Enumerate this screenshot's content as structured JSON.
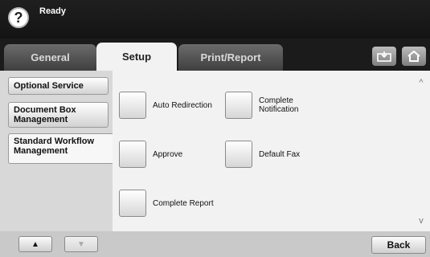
{
  "header": {
    "help_glyph": "?",
    "status": "Ready"
  },
  "tabs": [
    {
      "label": "General"
    },
    {
      "label": "Setup"
    },
    {
      "label": "Print/Report"
    }
  ],
  "toolbar": {
    "icons": [
      "tray-icon",
      "home-icon"
    ]
  },
  "sidebar": {
    "items": [
      {
        "label": "Optional Service"
      },
      {
        "label": "Document Box Management"
      },
      {
        "label": "Standard Workflow Management"
      }
    ]
  },
  "options": [
    {
      "label": "Auto Redirection"
    },
    {
      "label": "Complete Notification"
    },
    {
      "label": "Approve"
    },
    {
      "label": "Default Fax"
    },
    {
      "label": "Complete Report"
    }
  ],
  "scroll": {
    "up": "^",
    "down": "v"
  },
  "footer": {
    "up_glyph": "▲",
    "down_glyph": "▼",
    "back_label": "Back"
  },
  "colors": {
    "header_bg": "#1b1b1b",
    "active_tab": "#f2f2f2",
    "sidebar_bg": "#d8d8d8",
    "footer_bg": "#c9c9c9"
  }
}
